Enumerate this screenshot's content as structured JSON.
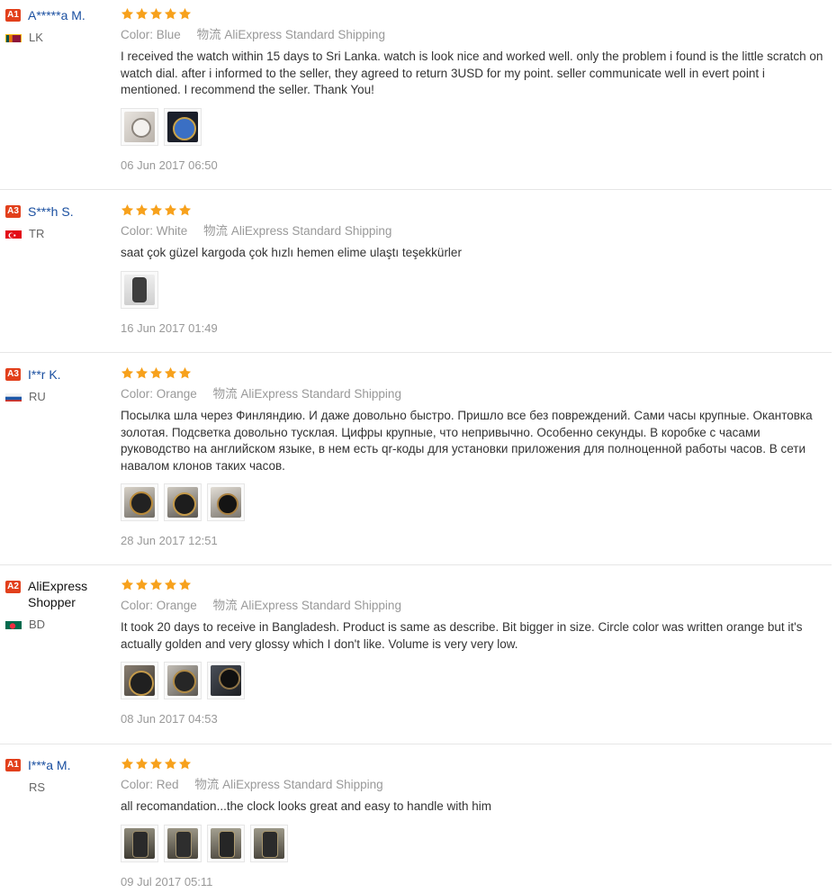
{
  "star_color": "#f7a11c",
  "reviews": [
    {
      "badge": "A1",
      "username": "A*****a M.",
      "country": "LK",
      "stars": 5,
      "color_label": "Color:",
      "color_value": "Blue",
      "shipping_label": "物流",
      "shipping_value": "AliExpress Standard Shipping",
      "text": "I received the watch within 15 days to Sri Lanka. watch is look nice and worked well. only the problem i found is the little scratch on watch dial. after i informed to the seller, they agreed to return 3USD for my point. seller communicate well in evert point i mentioned. I recommend the seller. Thank You!",
      "photo_count": 2,
      "date": "06 Jun 2017 06:50"
    },
    {
      "badge": "A3",
      "username": "S***h S.",
      "country": "TR",
      "stars": 5,
      "color_label": "Color:",
      "color_value": "White",
      "shipping_label": "物流",
      "shipping_value": "AliExpress Standard Shipping",
      "text": "saat çok güzel kargoda çok hızlı hemen elime ulaştı teşekkürler",
      "photo_count": 1,
      "date": "16 Jun 2017 01:49"
    },
    {
      "badge": "A3",
      "username": "I**r K.",
      "country": "RU",
      "stars": 5,
      "color_label": "Color:",
      "color_value": "Orange",
      "shipping_label": "物流",
      "shipping_value": "AliExpress Standard Shipping",
      "text": "Посылка шла через Финляндию. И даже довольно быстро. Пришло все без повреждений. Сами часы крупные. Окантовка золотая. Подсветка довольно тусклая. Цифры крупные, что непривычно. Особенно секунды. В коробке с часами руководство на английском языке, в нем есть qr-коды для установки приложения для полноценной работы часов. В сети навалом клонов таких часов.",
      "photo_count": 3,
      "date": "28 Jun 2017 12:51"
    },
    {
      "badge": "A2",
      "username": "AliExpress Shopper",
      "country": "BD",
      "stars": 5,
      "color_label": "Color:",
      "color_value": "Orange",
      "shipping_label": "物流",
      "shipping_value": "AliExpress Standard Shipping",
      "text": "It took 20 days to receive in Bangladesh. Product is same as describe. Bit bigger in size. Circle color was written orange but it's actually golden and very glossy which I don't like. Volume is very very low.",
      "photo_count": 3,
      "date": "08 Jun 2017 04:53"
    },
    {
      "badge": "A1",
      "username": "I***a M.",
      "country": "RS",
      "stars": 5,
      "color_label": "Color:",
      "color_value": "Red",
      "shipping_label": "物流",
      "shipping_value": "AliExpress Standard Shipping",
      "text": "all recomandation...the clock looks great and easy to handle with him",
      "photo_count": 4,
      "date": "09 Jul 2017 05:11"
    }
  ]
}
